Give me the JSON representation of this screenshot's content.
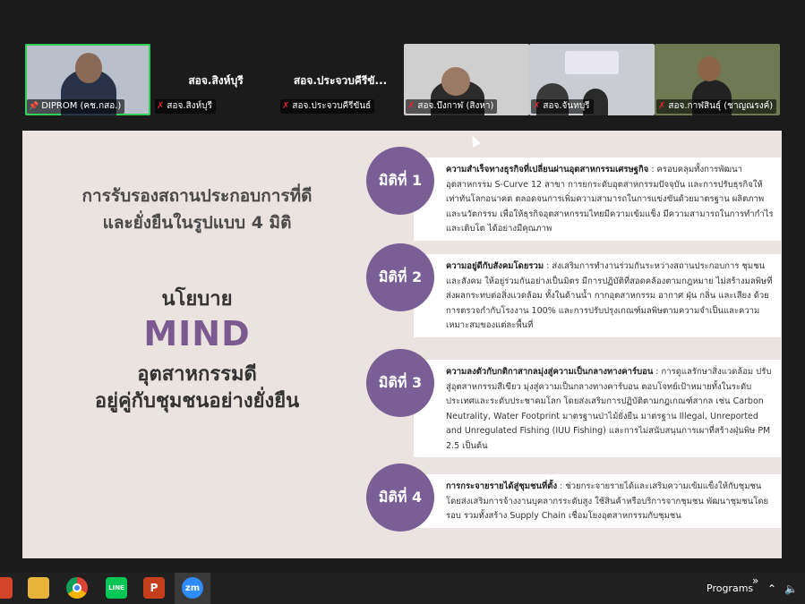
{
  "participants": [
    {
      "label": "DIPROM (คช.กสอ.)",
      "type": "video",
      "muted": false
    },
    {
      "name": "สอจ.สิงห์บุรี",
      "label": "สอจ.สิงห์บุรี",
      "type": "name",
      "muted": true
    },
    {
      "name": "สอจ.ประจวบคีรีขั...",
      "label": "สอจ.ประจวบคีรีขันธ์",
      "type": "name",
      "muted": true
    },
    {
      "label": "สอจ.บึงกาฬ (สิงหา)",
      "type": "video",
      "muted": true
    },
    {
      "label": "สอจ.จันทบุรี",
      "type": "video",
      "muted": true
    },
    {
      "label": "สอจ.กาฬสินธุ์ (ชาญณรงค์)",
      "type": "video",
      "muted": true
    }
  ],
  "slide": {
    "heading_line1": "การรับรองสถานประกอบการที่ดี",
    "heading_line2": "และยั่งยืนในรูปแบบ 4 มิติ",
    "policy": "นโยบาย",
    "mind": "MIND",
    "subtitle_line1": "อุตสาหกรรมดี",
    "subtitle_line2": "อยู่คู่กับชุมชนอย่างยั่งยืน",
    "dimensions": [
      {
        "label": "มิติที่ 1",
        "title": "ความสำเร็จทางธุรกิจที่เปลี่ยนผ่านอุตสาหกรรมเศรษฐกิจ",
        "body": " : ครอบคลุมทั้งการพัฒนาอุตสาหกรรม S-Curve 12 สาขา การยกระดับอุตสาหกรรมปัจจุบัน และการปรับธุรกิจให้เท่าทันโลกอนาคต ตลอดจนการเพิ่มความสามารถในการแข่งขันด้วยมาตรฐาน ผลิตภาพและนวัตกรรม เพื่อให้ธุรกิจอุตสาหกรรมไทยมีความเข้มแข็ง มีความสามารถในการทำกำไรและเติบโต ได้อย่างมีคุณภาพ"
      },
      {
        "label": "มิติที่ 2",
        "title": "ความอยู่ดีกับสังคมโดยรวม",
        "body": " : ส่งเสริมการทำงานร่วมกันระหว่างสถานประกอบการ ชุมชน และสังคม ให้อยู่ร่วมกันอย่างเป็นมิตร มีการปฏิบัติที่สอดคล้องตามกฎหมาย ไม่สร้างมลพิษที่ส่งผลกระทบต่อสิ่งแวดล้อม ทั้งในด้านน้ำ กากอุตสาหกรรม อากาศ ฝุ่น กลิ่น และเสียง ด้วยการตรวจกำกับโรงงาน 100% และการปรับปรุงเกณฑ์มลพิษตามความจำเป็นและความเหมาะสมของแต่ละพื้นที่"
      },
      {
        "label": "มิติที่ 3",
        "title": "ความลงตัวกับกติกาสากลมุ่งสู่ความเป็นกลางทางคาร์บอน",
        "body": " : การดูแลรักษาสิ่งแวดล้อม ปรับสู่อุตสาหกรรมสีเขียว มุ่งสู่ความเป็นกลางทางคาร์บอน ตอบโจทย์เป้าหมายทั้งในระดับประเทศและระดับประชาคมโลก โดยส่งเสริมการปฏิบัติตามกฎเกณฑ์สากล เช่น Carbon Neutrality, Water Footprint มาตรฐานป่าไม้ยั่งยืน มาตรฐาน Illegal, Unreported and Unregulated Fishing (IUU Fishing) และการไม่สนับสนุนการเผาที่สร้างฝุ่นพิษ PM 2.5 เป็นต้น"
      },
      {
        "label": "มิติที่ 4",
        "title": "การกระจายรายได้สู่ชุมชนที่ตั้ง",
        "body": " : ช่วยกระจายรายได้และเสริมความเข้มแข็งให้กับชุมชน โดยส่งเสริมการจ้างงานบุคลากรระดับสูง ใช้สินค้าหรือบริการจากชุมชน พัฒนาชุมชนโดยรอบ รวมทั้งสร้าง Supply Chain เชื่อมโยงอุตสาหกรรมกับชุมชน"
      }
    ]
  },
  "taskbar": {
    "programs_label": "Programs",
    "chevron": "»",
    "zoom_label": "zm",
    "powerpoint_label": "P",
    "line_label": "LINE"
  }
}
